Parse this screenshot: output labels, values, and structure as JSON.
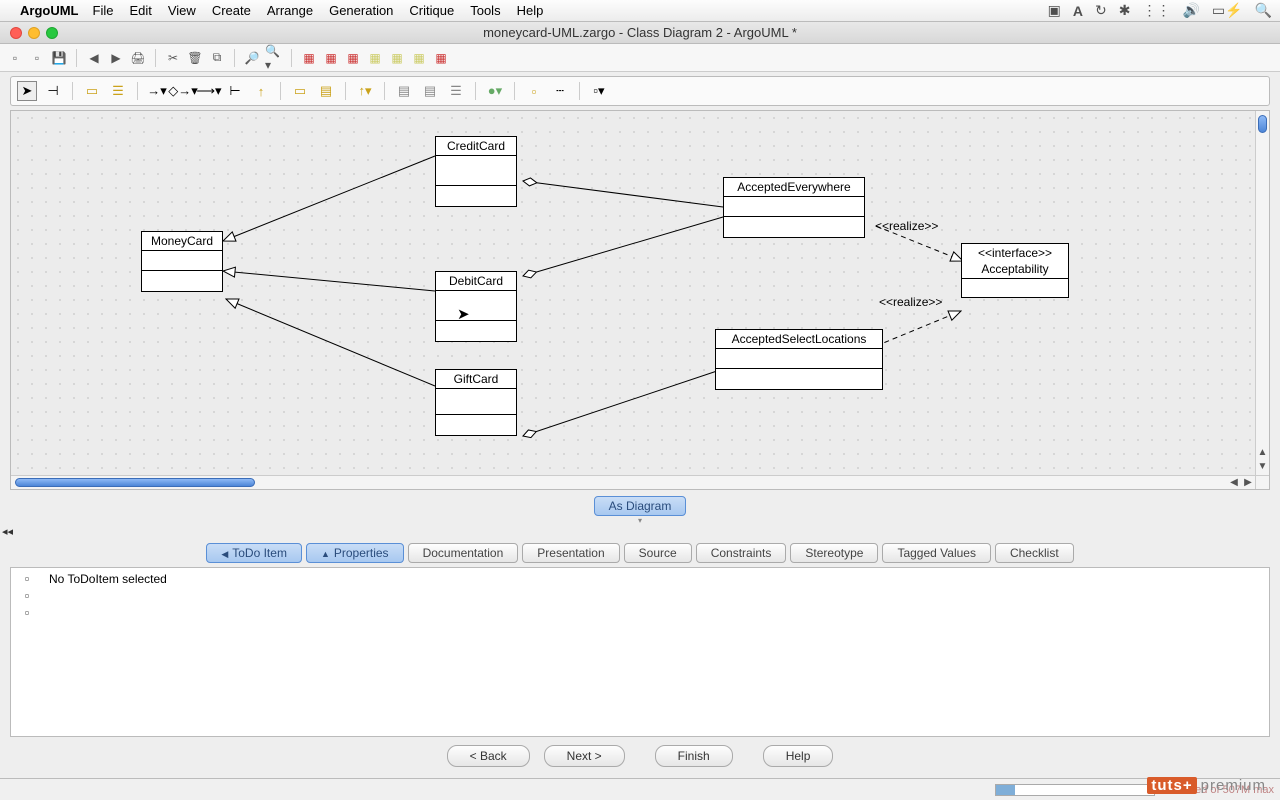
{
  "mac": {
    "app": "ArgoUML",
    "menus": [
      "File",
      "Edit",
      "View",
      "Create",
      "Arrange",
      "Generation",
      "Critique",
      "Tools",
      "Help"
    ]
  },
  "window": {
    "title": "moneycard-UML.zargo - Class Diagram 2 - ArgoUML *"
  },
  "as_diagram": "As Diagram",
  "tabs": {
    "todo": "ToDo Item",
    "properties": "Properties",
    "documentation": "Documentation",
    "presentation": "Presentation",
    "source": "Source",
    "constraints": "Constraints",
    "stereotype": "Stereotype",
    "tagged": "Tagged Values",
    "checklist": "Checklist"
  },
  "detail": {
    "no_todo": "No ToDoItem selected"
  },
  "wizard": {
    "back": "< Back",
    "next": "Next >",
    "finish": "Finish",
    "help": "Help"
  },
  "status": {
    "mem": "35M used of 507M max"
  },
  "brand": {
    "a": "tuts+",
    "b": "premium"
  },
  "uml": {
    "moneycard": "MoneyCard",
    "creditcard": "CreditCard",
    "debitcard": "DebitCard",
    "giftcard": "GiftCard",
    "accepted_everywhere": "AcceptedEverywhere",
    "accepted_select": "AcceptedSelectLocations",
    "acceptability_stereo": "<<interface>>",
    "acceptability": "Acceptability",
    "realize": "<<realize>>"
  }
}
